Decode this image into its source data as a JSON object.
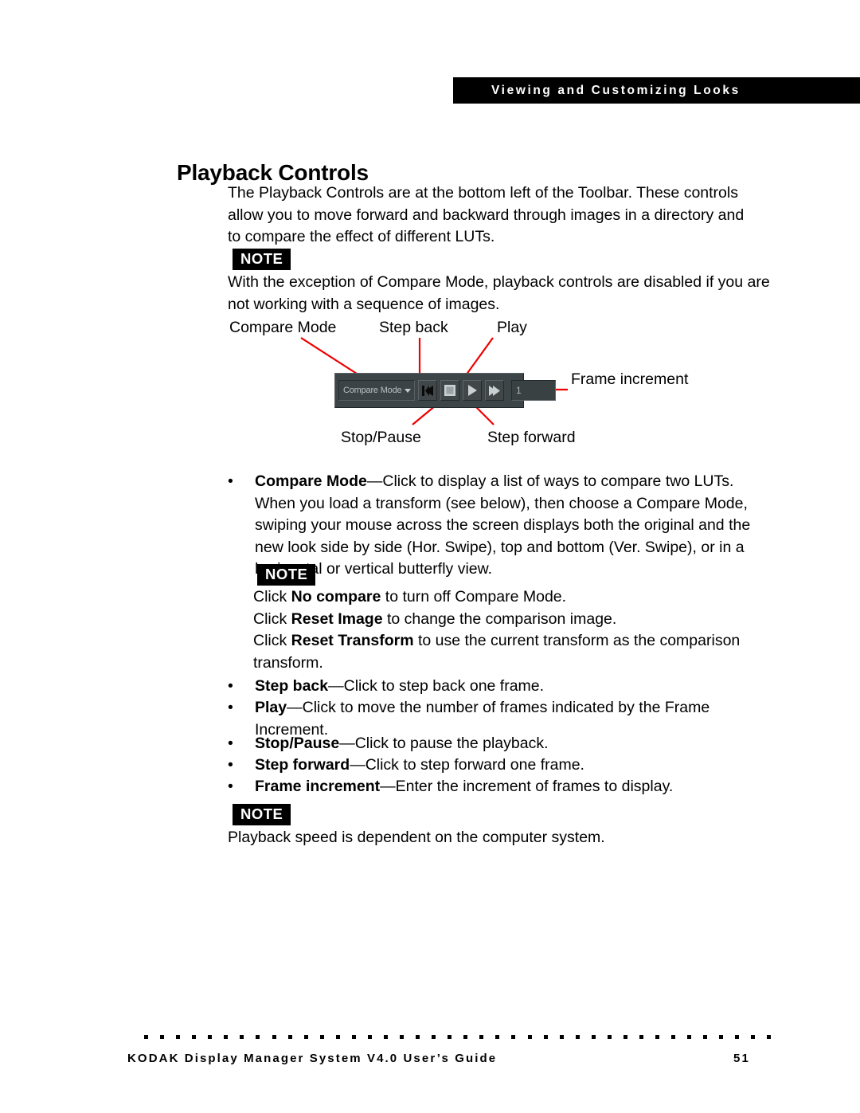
{
  "header": {
    "running_title": "Viewing and Customizing Looks"
  },
  "title": "Playback Controls",
  "intro": "The Playback Controls are at the bottom left of the Toolbar. These controls allow you to move forward and backward through images in a directory and to compare the effect of different LUTs.",
  "note1": {
    "label": "NOTE",
    "text": "With the exception of Compare Mode, playback controls are disabled if you are not working with a sequence of images."
  },
  "figure": {
    "callouts": {
      "compare_mode": "Compare Mode",
      "step_back": "Step back",
      "play": "Play",
      "frame_increment": "Frame increment",
      "stop_pause": "Stop/Pause",
      "step_forward": "Step forward"
    },
    "toolbar": {
      "compare_mode_label": "Compare Mode",
      "dropdown_icon": "chevron-down-icon",
      "step_back_icon": "step-back-icon",
      "stop_pause_icon": "stop-pause-icon",
      "play_icon": "play-icon",
      "step_forward_icon": "step-forward-icon",
      "frame_increment_value": "1"
    },
    "leader_color": "#ee0000",
    "panel_color": "#3e4548"
  },
  "bullets": [
    {
      "marker": "•",
      "term": "Compare Mode",
      "dash": "—",
      "text": "Click to display a list of ways to compare two LUTs. When you load a transform (see below), then choose a Compare Mode, swiping your mouse across the screen displays both the original and the new look side by side (Hor. Swipe), top and bottom (Ver. Swipe), or in a horizontal or vertical butterfly view."
    },
    {
      "marker": "•",
      "term": "Step back",
      "dash": "—",
      "text": "Click to step back one frame."
    },
    {
      "marker": "•",
      "term": "Play",
      "dash": "—",
      "text": "Click to move the number of frames indicated by the Frame Increment."
    },
    {
      "marker": "•",
      "term": "Stop/Pause",
      "dash": "—",
      "text": "Click to pause the playback."
    },
    {
      "marker": "•",
      "term": "Step forward",
      "dash": "—",
      "text": "Click to step forward one frame."
    },
    {
      "marker": "•",
      "term": "Frame increment",
      "dash": "—",
      "text": "Enter the increment of frames to display."
    }
  ],
  "note2": {
    "label": "NOTE",
    "line1_prefix": "Click ",
    "line1_bold": "No compare",
    "line1_suffix": " to turn off Compare Mode.",
    "line2_prefix": "Click ",
    "line2_bold": "Reset Image",
    "line2_suffix": " to change the comparison image.",
    "line3_prefix": "Click ",
    "line3_bold": "Reset Transform",
    "line3_suffix": " to use the current transform as the comparison transform."
  },
  "note3": {
    "label": "NOTE",
    "text": "Playback speed is dependent on the computer system."
  },
  "footer": {
    "left": "KODAK Display Manager System V4.0 User’s Guide",
    "page": "51"
  }
}
